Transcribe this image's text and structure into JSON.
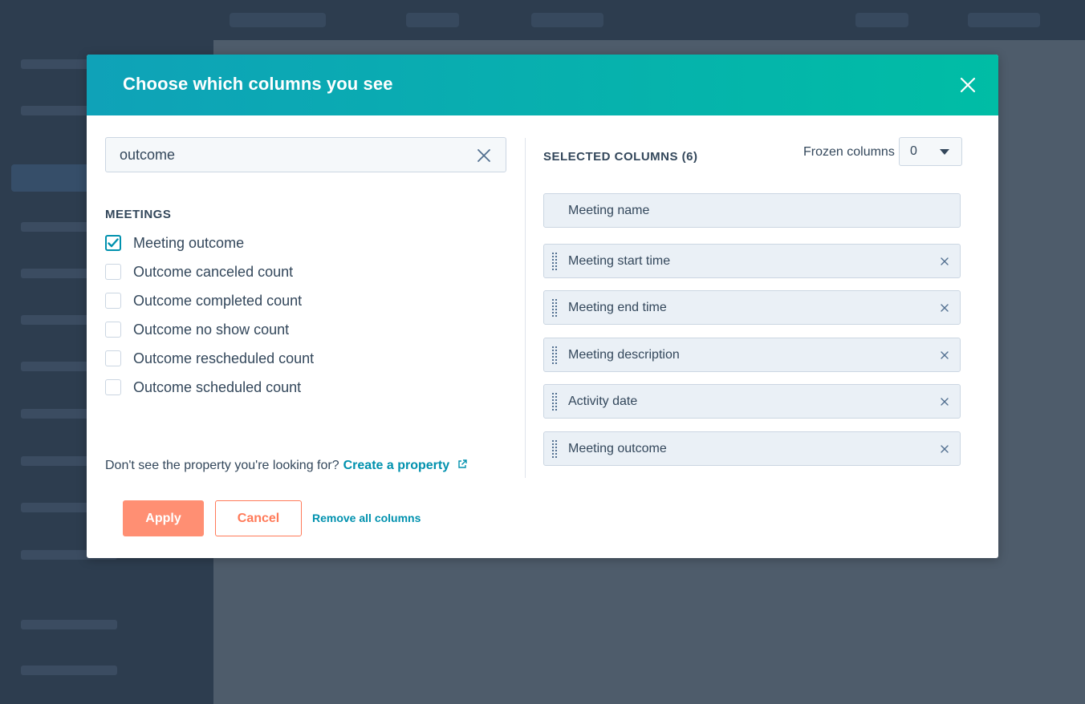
{
  "modal": {
    "title": "Choose which columns you see",
    "close_icon": "close-icon"
  },
  "search": {
    "value": "outcome",
    "placeholder": "Search",
    "clear_icon": "clear-icon"
  },
  "property_group": {
    "heading": "MEETINGS",
    "options": [
      {
        "label": "Meeting outcome",
        "checked": true
      },
      {
        "label": "Outcome canceled count",
        "checked": false
      },
      {
        "label": "Outcome completed count",
        "checked": false
      },
      {
        "label": "Outcome no show count",
        "checked": false
      },
      {
        "label": "Outcome rescheduled count",
        "checked": false
      },
      {
        "label": "Outcome scheduled count",
        "checked": false
      }
    ]
  },
  "hint": {
    "text": "Don't see the property you're looking for?",
    "link": "Create a property",
    "link_icon": "external-link-icon"
  },
  "selected": {
    "heading": "SELECTED COLUMNS (6)",
    "frozen_label": "Frozen columns",
    "frozen_value": "0",
    "columns": [
      {
        "label": "Meeting name",
        "removable": false
      },
      {
        "label": "Meeting start time",
        "removable": true
      },
      {
        "label": "Meeting end time",
        "removable": true
      },
      {
        "label": "Meeting description",
        "removable": true
      },
      {
        "label": "Activity date",
        "removable": true
      },
      {
        "label": "Meeting outcome",
        "removable": true
      }
    ]
  },
  "footer": {
    "apply_label": "Apply",
    "cancel_label": "Cancel",
    "remove_all_label": "Remove all columns"
  },
  "colors": {
    "header_start": "#0fa2b8",
    "header_end": "#00bda5",
    "primary_text": "#33475b",
    "link": "#0091ae",
    "apply": "#ff8f73",
    "cancel": "#ff7a59"
  }
}
